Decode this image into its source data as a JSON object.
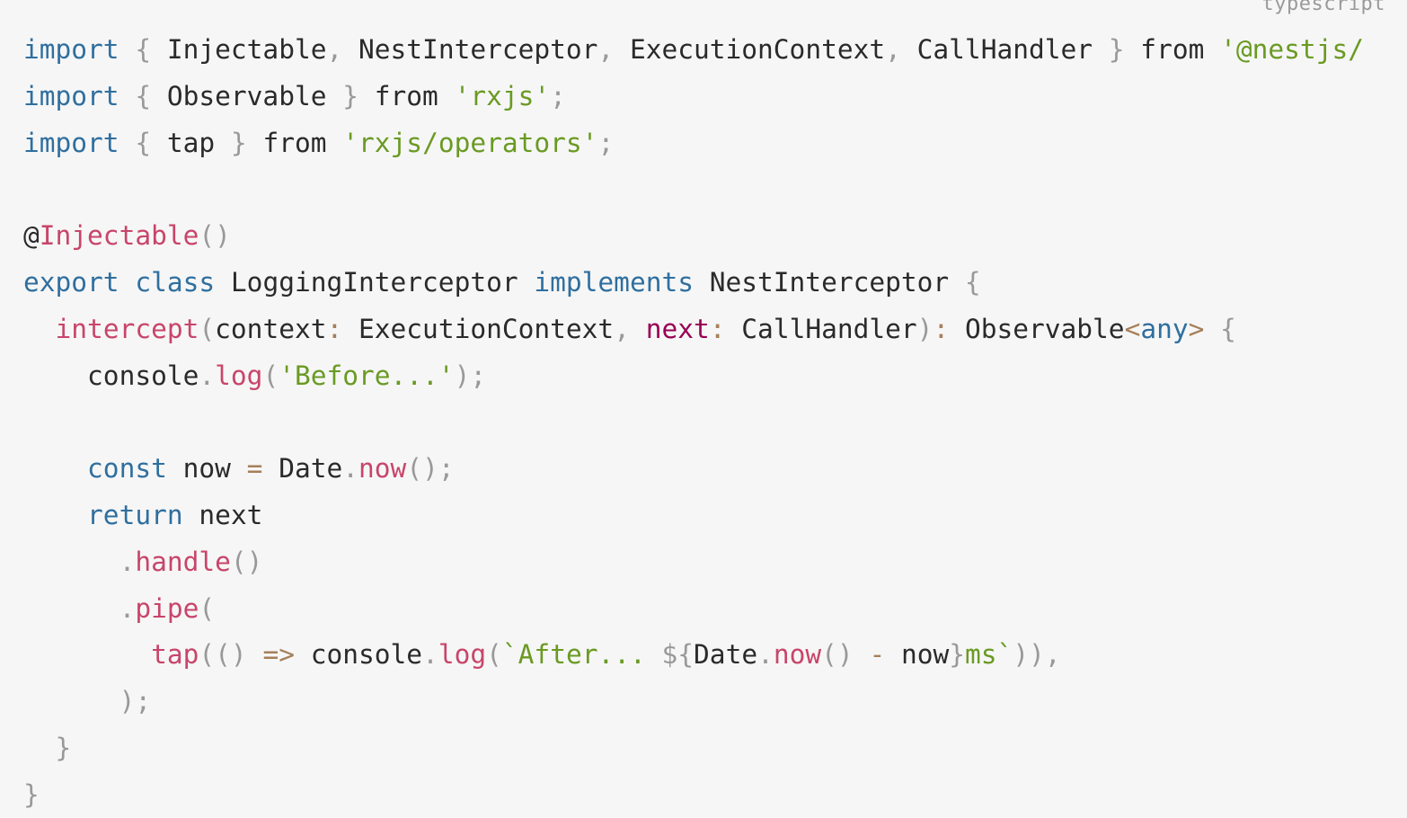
{
  "language_label": "typescript",
  "colors": {
    "background": "#f6f6f6",
    "keyword": "#2f6f9f",
    "string": "#6a9a23",
    "function": "#c8456a",
    "parameter": "#990055",
    "operator": "#a67f59",
    "punctuation": "#999999",
    "text": "#2a2a2a"
  },
  "lines": [
    [
      [
        "kw",
        "import"
      ],
      [
        "tx",
        " "
      ],
      [
        "pu",
        "{"
      ],
      [
        "tx",
        " Injectable"
      ],
      [
        "pu",
        ","
      ],
      [
        "tx",
        " NestInterceptor"
      ],
      [
        "pu",
        ","
      ],
      [
        "tx",
        " ExecutionContext"
      ],
      [
        "pu",
        ","
      ],
      [
        "tx",
        " CallHandler "
      ],
      [
        "pu",
        "}"
      ],
      [
        "tx",
        " from "
      ],
      [
        "str",
        "'@nestjs/"
      ]
    ],
    [
      [
        "kw",
        "import"
      ],
      [
        "tx",
        " "
      ],
      [
        "pu",
        "{"
      ],
      [
        "tx",
        " Observable "
      ],
      [
        "pu",
        "}"
      ],
      [
        "tx",
        " from "
      ],
      [
        "str",
        "'rxjs'"
      ],
      [
        "pu",
        ";"
      ]
    ],
    [
      [
        "kw",
        "import"
      ],
      [
        "tx",
        " "
      ],
      [
        "pu",
        "{"
      ],
      [
        "tx",
        " tap "
      ],
      [
        "pu",
        "}"
      ],
      [
        "tx",
        " from "
      ],
      [
        "str",
        "'rxjs/operators'"
      ],
      [
        "pu",
        ";"
      ]
    ],
    [],
    [
      [
        "tx",
        "@"
      ],
      [
        "fn",
        "Injectable"
      ],
      [
        "pu",
        "()"
      ]
    ],
    [
      [
        "kw",
        "export"
      ],
      [
        "tx",
        " "
      ],
      [
        "kw",
        "class"
      ],
      [
        "tx",
        " LoggingInterceptor "
      ],
      [
        "kw",
        "implements"
      ],
      [
        "tx",
        " NestInterceptor "
      ],
      [
        "pu",
        "{"
      ]
    ],
    [
      [
        "tx",
        "  "
      ],
      [
        "fn",
        "intercept"
      ],
      [
        "pu",
        "("
      ],
      [
        "tx",
        "context"
      ],
      [
        "op",
        ":"
      ],
      [
        "tx",
        " ExecutionContext"
      ],
      [
        "pu",
        ","
      ],
      [
        "tx",
        " "
      ],
      [
        "param",
        "next"
      ],
      [
        "op",
        ":"
      ],
      [
        "tx",
        " CallHandler"
      ],
      [
        "pu",
        ")"
      ],
      [
        "op",
        ":"
      ],
      [
        "tx",
        " Observable"
      ],
      [
        "op",
        "<"
      ],
      [
        "kw",
        "any"
      ],
      [
        "op",
        ">"
      ],
      [
        "tx",
        " "
      ],
      [
        "pu",
        "{"
      ]
    ],
    [
      [
        "tx",
        "    console"
      ],
      [
        "pu",
        "."
      ],
      [
        "fn",
        "log"
      ],
      [
        "pu",
        "("
      ],
      [
        "str",
        "'Before...'"
      ],
      [
        "pu",
        ");"
      ]
    ],
    [],
    [
      [
        "tx",
        "    "
      ],
      [
        "kw",
        "const"
      ],
      [
        "tx",
        " now "
      ],
      [
        "op",
        "="
      ],
      [
        "tx",
        " Date"
      ],
      [
        "pu",
        "."
      ],
      [
        "fn",
        "now"
      ],
      [
        "pu",
        "();"
      ]
    ],
    [
      [
        "tx",
        "    "
      ],
      [
        "kw",
        "return"
      ],
      [
        "tx",
        " next"
      ]
    ],
    [
      [
        "tx",
        "      "
      ],
      [
        "pu",
        "."
      ],
      [
        "fn",
        "handle"
      ],
      [
        "pu",
        "()"
      ]
    ],
    [
      [
        "tx",
        "      "
      ],
      [
        "pu",
        "."
      ],
      [
        "fn",
        "pipe"
      ],
      [
        "pu",
        "("
      ]
    ],
    [
      [
        "tx",
        "        "
      ],
      [
        "fn",
        "tap"
      ],
      [
        "pu",
        "(()"
      ],
      [
        "tx",
        " "
      ],
      [
        "op",
        "=>"
      ],
      [
        "tx",
        " console"
      ],
      [
        "pu",
        "."
      ],
      [
        "fn",
        "log"
      ],
      [
        "pu",
        "("
      ],
      [
        "str",
        "`After... "
      ],
      [
        "pu",
        "${"
      ],
      [
        "tx",
        "Date"
      ],
      [
        "pu",
        "."
      ],
      [
        "fn",
        "now"
      ],
      [
        "pu",
        "()"
      ],
      [
        "tx",
        " "
      ],
      [
        "op",
        "-"
      ],
      [
        "tx",
        " now"
      ],
      [
        "pu",
        "}"
      ],
      [
        "str",
        "ms`"
      ],
      [
        "pu",
        "))"
      ],
      [
        "pu",
        ","
      ]
    ],
    [
      [
        "tx",
        "      "
      ],
      [
        "pu",
        ");"
      ]
    ],
    [
      [
        "tx",
        "  "
      ],
      [
        "pu",
        "}"
      ]
    ],
    [
      [
        "pu",
        "}"
      ]
    ]
  ]
}
